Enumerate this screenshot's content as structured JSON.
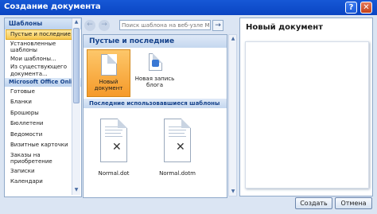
{
  "window": {
    "title": "Создание документа",
    "help": "?",
    "close": "✕"
  },
  "sidebar": {
    "header": "Шаблоны",
    "items": [
      {
        "label": "Пустые и последние",
        "type": "sel"
      },
      {
        "label": "Установленные шаблоны",
        "type": "item"
      },
      {
        "label": "Мои шаблоны...",
        "type": "item"
      },
      {
        "label": "Из существующего документа...",
        "type": "item"
      },
      {
        "label": "Microsoft Office Online",
        "type": "group"
      },
      {
        "label": "Готовые",
        "type": "row"
      },
      {
        "label": "Бланки",
        "type": "row"
      },
      {
        "label": "Брошюры",
        "type": "row"
      },
      {
        "label": "Бюллетени",
        "type": "row"
      },
      {
        "label": "Ведомости",
        "type": "row"
      },
      {
        "label": "Визитные карточки",
        "type": "row"
      },
      {
        "label": "Заказы на приобретение",
        "type": "item"
      },
      {
        "label": "Записки",
        "type": "row"
      },
      {
        "label": "Календари",
        "type": "row"
      }
    ]
  },
  "search": {
    "placeholder": "Поиск шаблона на веб-узле Microsoft Office Online",
    "back": "←",
    "forward": "→",
    "go": "→"
  },
  "middle": {
    "section1": "Пустые и последние",
    "tiles": [
      {
        "label": "Новый документ"
      },
      {
        "label": "Новая запись блога"
      }
    ],
    "section2": "Последние использовавшиеся шаблоны",
    "recent": [
      {
        "label": "Normal.dot"
      },
      {
        "label": "Normal.dotm"
      }
    ]
  },
  "preview": {
    "title": "Новый документ"
  },
  "buttons": {
    "create": "Создать",
    "cancel": "Отмена"
  }
}
